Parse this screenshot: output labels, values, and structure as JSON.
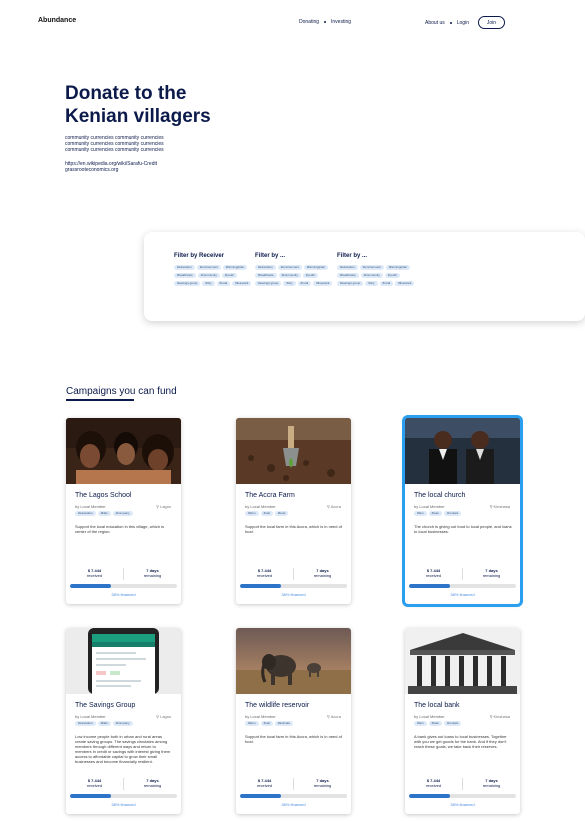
{
  "header": {
    "logo": "Abundance",
    "nav_center": [
      "Donating",
      "Investing"
    ],
    "about": "About us",
    "login": "Login",
    "join": "Join"
  },
  "hero": {
    "title_line1": "Donate to the",
    "title_line2": "Kenian villagers",
    "desc_lines": [
      "community currencies community currencies",
      "community currencies community currencies",
      "community currencies community currencies"
    ],
    "links": [
      "https://en.wikipedia.org/wiki/Sarafu-Credit",
      "grassrooteconomics.org"
    ]
  },
  "filters": [
    {
      "title": "Filter by Receiver",
      "chips": [
        "#education",
        "#environment",
        "#farming/plan",
        "#healthcare",
        "#community",
        "#youth",
        "#savings group",
        "#city",
        "#rural",
        "#livestock"
      ]
    },
    {
      "title": "Filter by ...",
      "chips": [
        "#education",
        "#environment",
        "#farming/plan",
        "#healthcare",
        "#community",
        "#youth",
        "#savings group",
        "#city",
        "#rural",
        "#livestock"
      ]
    },
    {
      "title": "Filter by ...",
      "chips": [
        "#education",
        "#environment",
        "#farming/plan",
        "#healthcare",
        "#community",
        "#youth",
        "#savings group",
        "#city",
        "#rural",
        "#livestock"
      ]
    }
  ],
  "campaigns_title": "Campaigns you can fund",
  "cards": [
    {
      "title": "The Lagos School",
      "by": "by Local Member",
      "location": "Lagos",
      "tags": [
        "#education",
        "#kids",
        "#company"
      ],
      "desc": "Support the local education in this village, which is center of the region.",
      "amount": "$ 7.444",
      "amount_label": "received",
      "days": "7 days",
      "days_label": "remaining",
      "progress": 0.38,
      "financed": "38% financed",
      "image": "children-photo"
    },
    {
      "title": "The Accra Farm",
      "by": "by Local Member",
      "location": "Accra",
      "tags": [
        "#farm",
        "#soil",
        "#food"
      ],
      "desc": "Support the local farm in this Accra, which is in need of food.",
      "amount": "$ 7.444",
      "amount_label": "received",
      "days": "7 days",
      "days_label": "remaining",
      "progress": 0.38,
      "financed": "38% financed",
      "image": "soil-photo"
    },
    {
      "title": "The local church",
      "by": "by Local Member",
      "location": "Kinshasa",
      "tags": [
        "#fam",
        "#loan",
        "#contact"
      ],
      "desc": "The church is giving out food to local people, and loans to local businesses.",
      "amount": "$ 7.444",
      "amount_label": "received",
      "days": "7 days",
      "days_label": "remaining",
      "progress": 0.38,
      "financed": "38% financed",
      "image": "church-photo",
      "selected": true
    },
    {
      "title": "The Savings Group",
      "by": "by Local Member",
      "location": "Lagos",
      "tags": [
        "#education",
        "#kids",
        "#company"
      ],
      "desc": "Low income people both in urban and rural areas create saving groups. The savings circulates among members through different ways and return to members in credit or savings with interest giving them access to affordable capital to grow their small businesses and become financially resilient.",
      "amount": "$ 7.444",
      "amount_label": "received",
      "days": "7 days",
      "days_label": "remaining",
      "progress": 0.38,
      "financed": "38% financed",
      "image": "phone-photo"
    },
    {
      "title": "The wildlife reservoir",
      "by": "by Local Member",
      "location": "Accra",
      "tags": [
        "#farm",
        "#soil",
        "#animals"
      ],
      "desc": "Support the local farm in this Accra, which is in need of food.",
      "amount": "$ 7.444",
      "amount_label": "received",
      "days": "7 days",
      "days_label": "remaining",
      "progress": 0.38,
      "financed": "38% financed",
      "image": "elephant-photo"
    },
    {
      "title": "The local bank",
      "by": "by Local Member",
      "location": "Kinshasa",
      "tags": [
        "#fam",
        "#loan",
        "#contact"
      ],
      "desc": "A bank gives out loans to local businesses. Together with you we get goods for the bank. And if they don't reach these goals, we take back their reserves.",
      "amount": "$ 7.444",
      "amount_label": "received",
      "days": "7 days",
      "days_label": "remaining",
      "progress": 0.38,
      "financed": "38% financed",
      "image": "bank-photo"
    }
  ],
  "colors": {
    "navy": "#0b1a4a",
    "chip_bg": "#dde9f8",
    "progress": "#2d74c9",
    "selected_outline": "#2a9ff0"
  }
}
